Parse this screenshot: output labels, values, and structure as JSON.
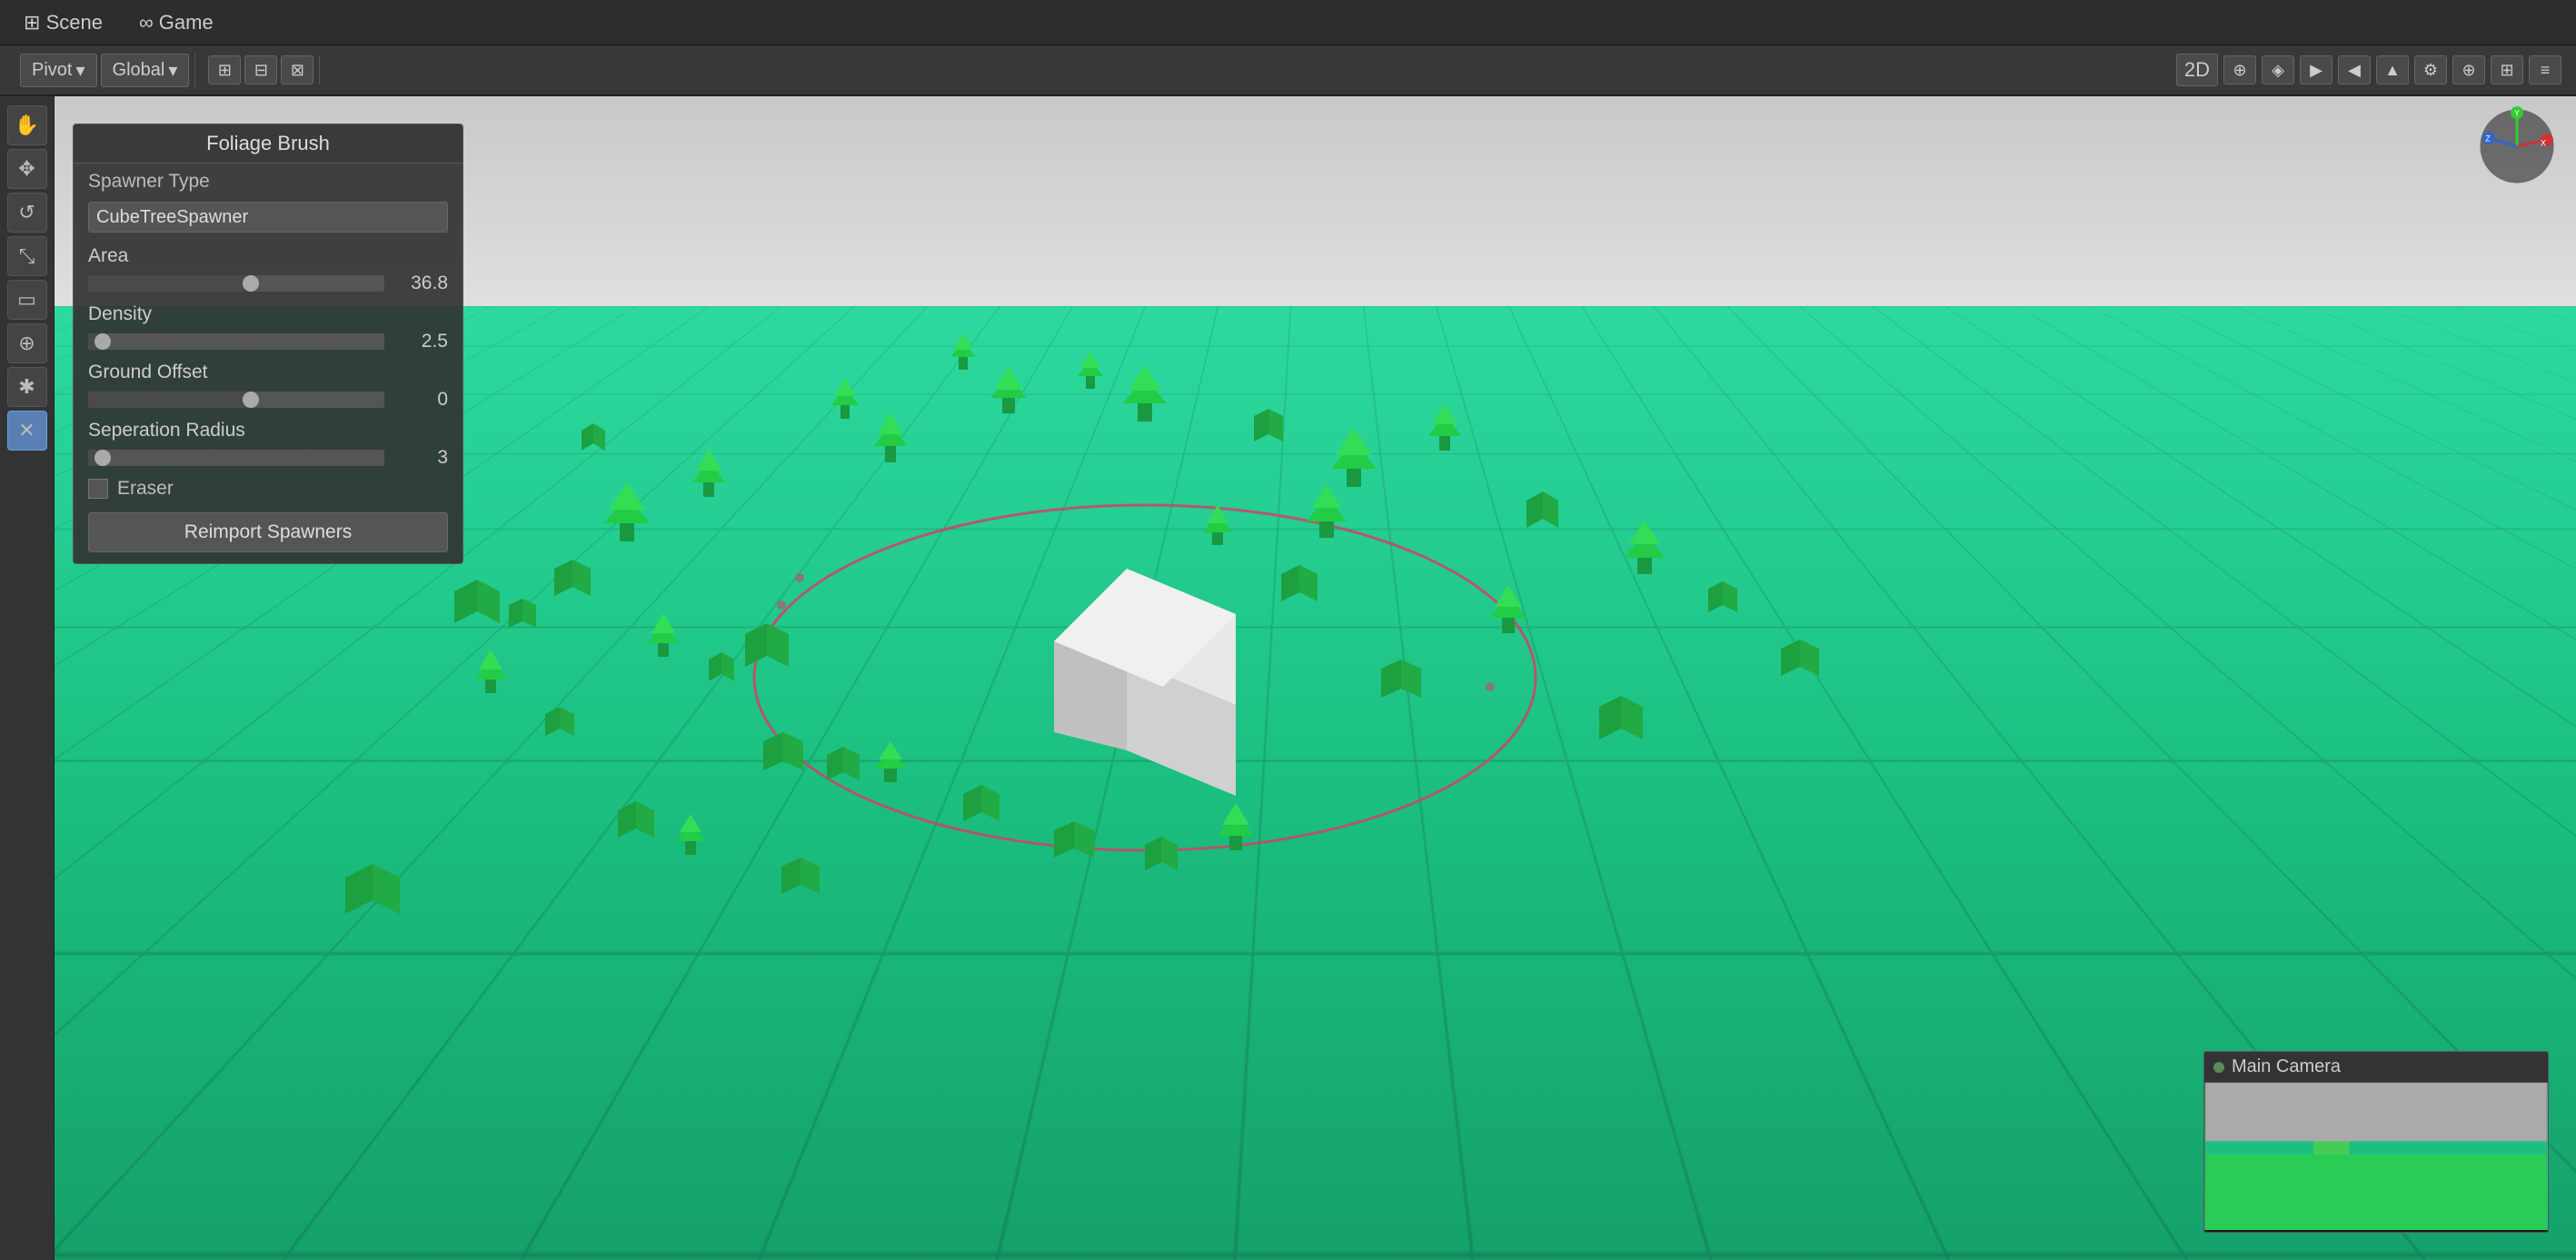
{
  "menu": {
    "scene_label": "Scene",
    "game_label": "Game",
    "scene_icon": "⊞",
    "game_icon": "∞"
  },
  "toolbar": {
    "pivot_label": "Pivot",
    "global_label": "Global",
    "pivot_dropdown": "▾",
    "global_dropdown": "▾",
    "mode_2d": "2D",
    "icons": [
      "⊞",
      "⊟",
      "↔",
      "↕"
    ],
    "right_icons": [
      "≡",
      "○",
      "◈",
      "▶",
      "◀",
      "▲",
      "⚙",
      "⊕",
      "⊞",
      "◉"
    ]
  },
  "left_tools": {
    "tools": [
      {
        "name": "hand",
        "icon": "✋",
        "active": false
      },
      {
        "name": "move",
        "icon": "✥",
        "active": false
      },
      {
        "name": "rotate",
        "icon": "↺",
        "active": false
      },
      {
        "name": "scale",
        "icon": "⤡",
        "active": false
      },
      {
        "name": "rect",
        "icon": "▭",
        "active": false
      },
      {
        "name": "transform",
        "icon": "⊕",
        "active": false
      },
      {
        "name": "custom1",
        "icon": "✱",
        "active": false
      },
      {
        "name": "custom2",
        "icon": "✕",
        "active": true
      }
    ]
  },
  "foliage_brush": {
    "title": "Foliage Brush",
    "spawner_type_label": "Spawner Type",
    "spawner_type_value": "CubeTreeSpawner",
    "area_label": "Area",
    "area_value": "36.8",
    "area_slider_pct": 55,
    "density_label": "Density",
    "density_value": "2.5",
    "density_slider_pct": 5,
    "ground_offset_label": "Ground Offset",
    "ground_offset_value": "0",
    "ground_offset_slider_pct": 55,
    "separation_radius_label": "Seperation Radius",
    "separation_radius_value": "3",
    "separation_radius_slider_pct": 5,
    "eraser_label": "Eraser",
    "reimport_btn": "Reimport Spawners"
  },
  "main_camera": {
    "title": "Main Camera",
    "dot_color": "#5a8a5a"
  },
  "scene_3d": {
    "brush_circle_color": "#cc4466",
    "tree_color": "#22bb44",
    "cube_color": "#33cc55",
    "center_cube_color": "#e0e0e0"
  }
}
